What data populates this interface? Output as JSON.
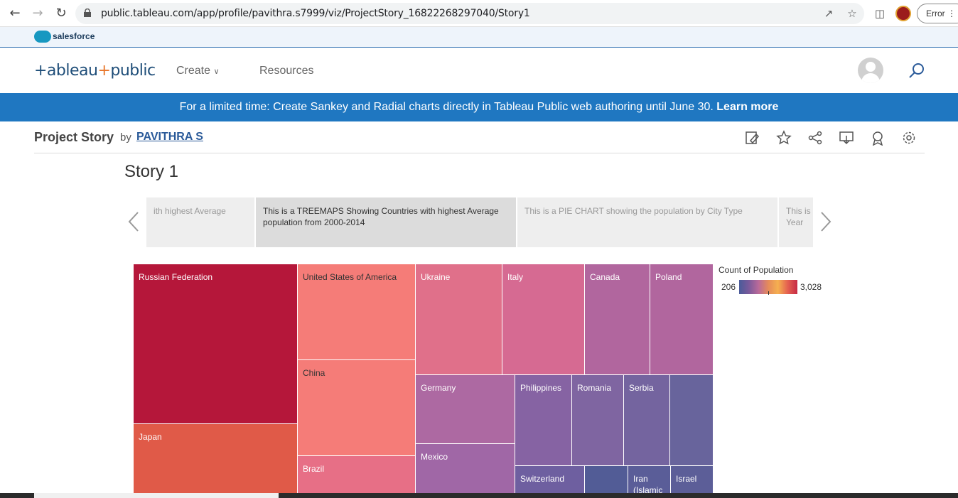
{
  "browser": {
    "url": "public.tableau.com/app/profile/pavithra.s7999/viz/ProjectStory_16822268297040/Story1",
    "error_label": "Error"
  },
  "salesforce": {
    "brand": "salesforce"
  },
  "header": {
    "logo": "+ableau+public",
    "logo_left": "+ableau",
    "logo_mark": "+",
    "logo_right": "public",
    "nav": [
      {
        "label": "Create"
      },
      {
        "label": "Resources"
      }
    ]
  },
  "banner": {
    "text": "For a limited time: Create Sankey and Radial charts directly in Tableau Public web authoring until June 30.",
    "link": "Learn more"
  },
  "viz": {
    "title": "Project Story",
    "by": "by",
    "author": "PAVITHRA S"
  },
  "story": {
    "title": "Story 1",
    "points": [
      {
        "text": "ith highest Average"
      },
      {
        "text": "This is a TREEMAPS Showing Countries with highest Average population from 2000-2014"
      },
      {
        "text": "This is a PIE CHART showing the population by City Type"
      },
      {
        "text": "This is Year"
      }
    ]
  },
  "legend": {
    "title": "Count of Population",
    "min": "206",
    "max": "3,028"
  },
  "treemap": {
    "cells": [
      {
        "label": "Russian Federation",
        "color": "#b5173a"
      },
      {
        "label": "Japan",
        "color": "#e05a48"
      },
      {
        "label": "United States of America",
        "color": "#f57c78"
      },
      {
        "label": "China",
        "color": "#f57c78"
      },
      {
        "label": "Brazil",
        "color": "#e76f86"
      },
      {
        "label": "Ukraine",
        "color": "#e0708a"
      },
      {
        "label": "Italy",
        "color": "#d66a92"
      },
      {
        "label": "Canada",
        "color": "#b1669e"
      },
      {
        "label": "Poland",
        "color": "#b1669e"
      },
      {
        "label": "Germany",
        "color": "#ad69a2"
      },
      {
        "label": "Mexico",
        "color": "#a067a6"
      },
      {
        "label": "Philippines",
        "color": "#8663a3"
      },
      {
        "label": "Romania",
        "color": "#7f65a1"
      },
      {
        "label": "Serbia",
        "color": "#74649f"
      },
      {
        "label": "",
        "color": "#68649c"
      },
      {
        "label": "Switzerland",
        "color": "#6e5fa0"
      },
      {
        "label": "",
        "color": "#525c96"
      },
      {
        "label": "Iran (Islamic",
        "color": "#5a5d98"
      },
      {
        "label": "Israel",
        "color": "#5c5e98"
      }
    ]
  }
}
